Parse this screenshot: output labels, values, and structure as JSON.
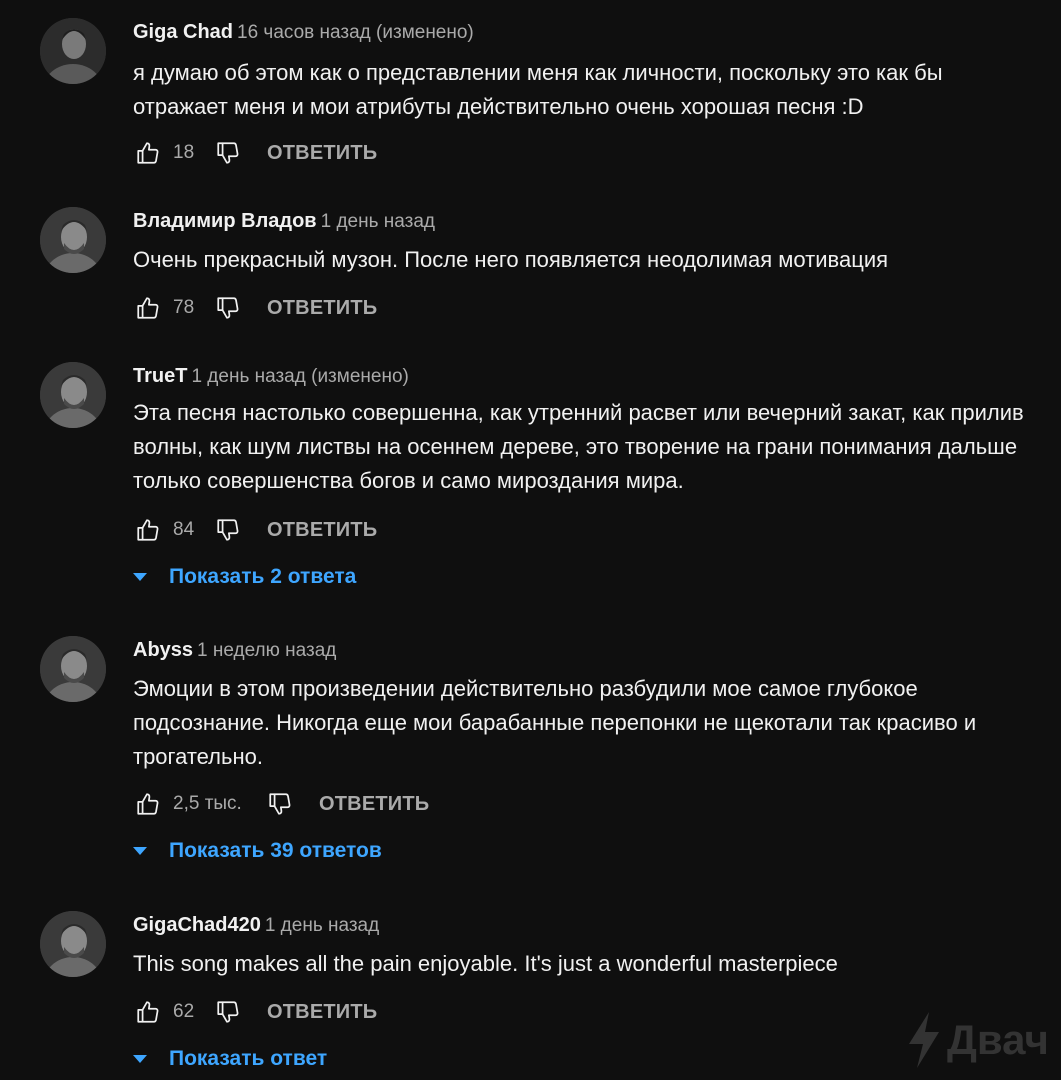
{
  "comments": [
    {
      "author": "Giga Chad",
      "time": "16 часов назад (изменено)",
      "text": "я думаю об этом как о представлении меня как личности, поскольку это как бы отражает меня и мои атрибуты действительно очень хорошая песня :D",
      "likes": "18",
      "reply_label": "ОТВЕТИТЬ",
      "show_replies": ""
    },
    {
      "author": "Владимир Владов",
      "time": "1 день назад",
      "text": "Очень прекрасный музон. После него появляется неодолимая мотивация",
      "likes": "78",
      "reply_label": "ОТВЕТИТЬ",
      "show_replies": ""
    },
    {
      "author": "TrueT",
      "time": "1 день назад (изменено)",
      "text": "Эта песня настолько совершенна, как утренний расвет или вечерний закат, как прилив волны, как шум листвы на осеннем дереве, это творение на грани понимания дальше только совершенства богов и само мироздания мира.",
      "likes": "84",
      "reply_label": "ОТВЕТИТЬ",
      "show_replies": "Показать 2 ответа"
    },
    {
      "author": "Abyss",
      "time": "1 неделю назад",
      "text": "Эмоции в этом произведении действительно разбудили мое самое глубокое подсознание. Никогда еще мои барабанные перепонки не щекотали так красиво и трогательно.",
      "likes": "2,5 тыс.",
      "reply_label": "ОТВЕТИТЬ",
      "show_replies": "Показать 39 ответов"
    },
    {
      "author": "GigaChad420",
      "time": "1 день назад",
      "text": "This song makes all the pain enjoyable. It's just a wonderful masterpiece",
      "likes": "62",
      "reply_label": "ОТВЕТИТЬ",
      "show_replies": "Показать ответ"
    }
  ],
  "watermark": "Двач",
  "icons": {
    "like": "thumbs-up-icon",
    "dislike": "thumbs-down-icon",
    "expand": "caret-down-icon",
    "watermark": "lightning-icon"
  },
  "colors": {
    "background": "#0f0f0f",
    "link": "#3ea6ff",
    "secondary_text": "#aaaaaa"
  }
}
